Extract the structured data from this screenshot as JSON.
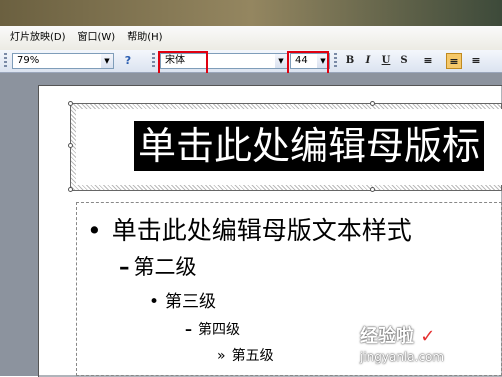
{
  "menubar": {
    "items": [
      {
        "label": "灯片放映(D)"
      },
      {
        "label": "窗口(W)"
      },
      {
        "label": "帮助(H)"
      }
    ]
  },
  "toolbar": {
    "zoom_value": "79%",
    "font_name_value": "宋体",
    "font_size_value": "44",
    "bold_label": "B",
    "italic_label": "I",
    "underline_label": "U",
    "shadow_label": "S",
    "highlight_color": "#e00010"
  },
  "slide": {
    "title_text": "单击此处编辑母版标",
    "body_levels": [
      {
        "bullet": "•",
        "text": "单击此处编辑母版文本样式"
      },
      {
        "bullet": "–",
        "text": "第二级"
      },
      {
        "bullet": "•",
        "text": "第三级"
      },
      {
        "bullet": "–",
        "text": "第四级"
      },
      {
        "bullet": "»",
        "text": "第五级"
      }
    ]
  },
  "watermark": {
    "title": "经验啦",
    "check": "✓",
    "url": "jingyanla.com"
  }
}
